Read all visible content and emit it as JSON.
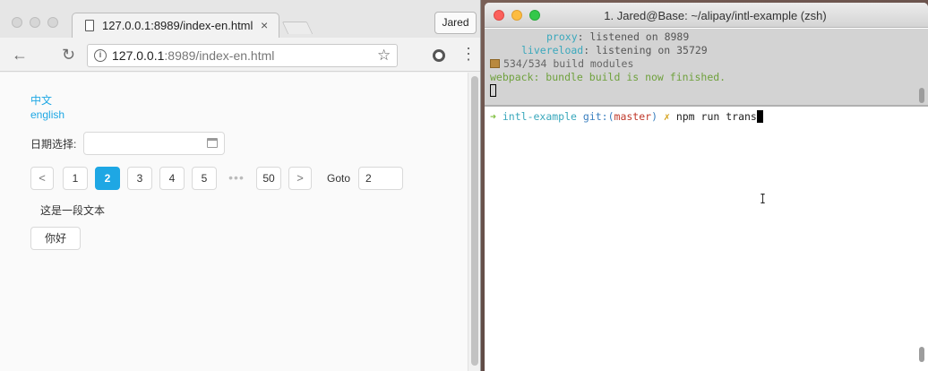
{
  "browser": {
    "tab_title": "127.0.0.1:8989/index-en.html",
    "tab_close": "×",
    "profile_label": "Jared",
    "url_host": "127.0.0.1",
    "url_path": ":8989/index-en.html",
    "page": {
      "lang_zh": "中文",
      "lang_en": "english",
      "date_label": "日期选择:",
      "date_value": "",
      "pagination": {
        "prev": "<",
        "pages": [
          "1",
          "2",
          "3",
          "4",
          "5"
        ],
        "active_page": "2",
        "ellipsis": "•••",
        "last": "50",
        "next": ">",
        "goto_label": "Goto",
        "goto_value": "2"
      },
      "paragraph": "这是一段文本",
      "button_label": "你好"
    }
  },
  "terminal": {
    "title": "1. Jared@Base: ~/alipay/intl-example (zsh)",
    "top_lines": [
      {
        "key": "proxy",
        "sep": ": ",
        "value": "listened on 8989"
      },
      {
        "key": "livereload",
        "sep": ": ",
        "value": "listening on 35729"
      }
    ],
    "modules_line": "534/534 build modules",
    "webpack_line": "webpack: bundle build is now finished.",
    "prompt": {
      "arrow": "➜",
      "dir": "intl-example",
      "git_label": "git:(",
      "branch": "master",
      "git_close": ")",
      "dirty": "✗",
      "command": "npm run trans"
    }
  },
  "colors": {
    "accent": "#1ea7e4",
    "term_cyan": "#3aa8bc",
    "term_green": "#6fa13d",
    "term_red": "#c0392b",
    "term_yellow": "#d4a017"
  }
}
